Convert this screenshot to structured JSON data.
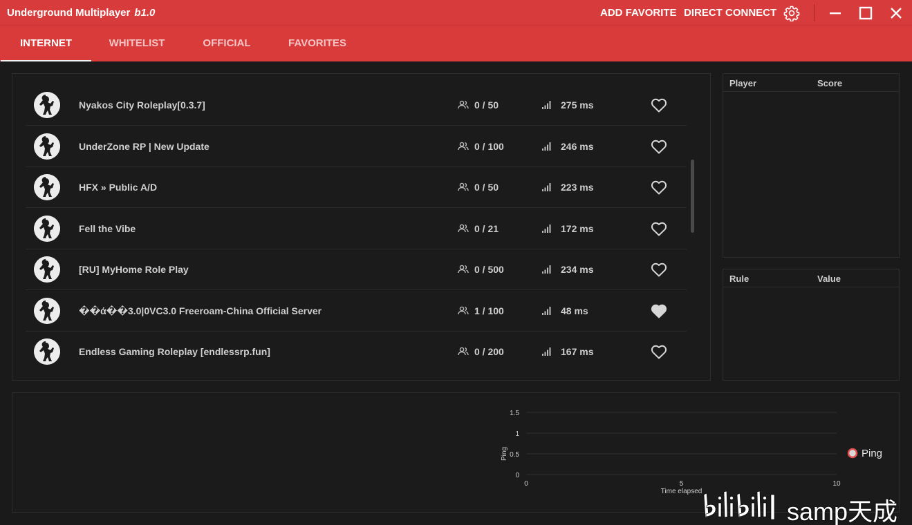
{
  "window": {
    "title": "Underground Multiplayer",
    "version": "b1.0",
    "actions": {
      "add_favorite": "ADD FAVORITE",
      "direct_connect": "DIRECT CONNECT"
    },
    "accent": "#d73b3b"
  },
  "tabs": [
    {
      "label": "INTERNET",
      "active": true
    },
    {
      "label": "WHITELIST",
      "active": false
    },
    {
      "label": "OFFICIAL",
      "active": false
    },
    {
      "label": "FAVORITES",
      "active": false
    }
  ],
  "servers": [
    {
      "name": "Nyakos City Roleplay[0.3.7]",
      "players": "0 / 50",
      "ping": "275 ms",
      "favorite": false
    },
    {
      "name": "UnderZone RP | New Update",
      "players": "0 / 100",
      "ping": "246 ms",
      "favorite": false
    },
    {
      "name": "HFX » Public A/D",
      "players": "0 / 50",
      "ping": "223 ms",
      "favorite": false
    },
    {
      "name": "Fell the Vibe",
      "players": "0 / 21",
      "ping": "172 ms",
      "favorite": false
    },
    {
      "name": "[RU] MyHome Role Play",
      "players": "0 / 500",
      "ping": "234 ms",
      "favorite": false
    },
    {
      "name": "��ά��3.0|0VC3.0 Freeroam-China Official Server",
      "players": "1 / 100",
      "ping": "48 ms",
      "favorite": true
    },
    {
      "name": "Endless Gaming Roleplay [endlessrp.fun]",
      "players": "0 / 200",
      "ping": "167 ms",
      "favorite": false
    }
  ],
  "player_table": {
    "col_player": "Player",
    "col_score": "Score"
  },
  "rule_table": {
    "col_rule": "Rule",
    "col_value": "Value"
  },
  "chart_data": {
    "type": "line",
    "title": "",
    "xlabel": "Time elapsed",
    "ylabel": "Ping",
    "x_ticks": [
      "0",
      "5",
      "10"
    ],
    "y_ticks": [
      "0",
      "0.5",
      "1",
      "1.5"
    ],
    "xlim": [
      0,
      10
    ],
    "ylim": [
      0,
      1.5
    ],
    "grid": true,
    "legend": "right",
    "series": [
      {
        "name": "Ping",
        "x": [],
        "y": [],
        "color": "#e05050"
      }
    ]
  },
  "watermark": {
    "text": "samp天成",
    "logo": "bilibili"
  }
}
